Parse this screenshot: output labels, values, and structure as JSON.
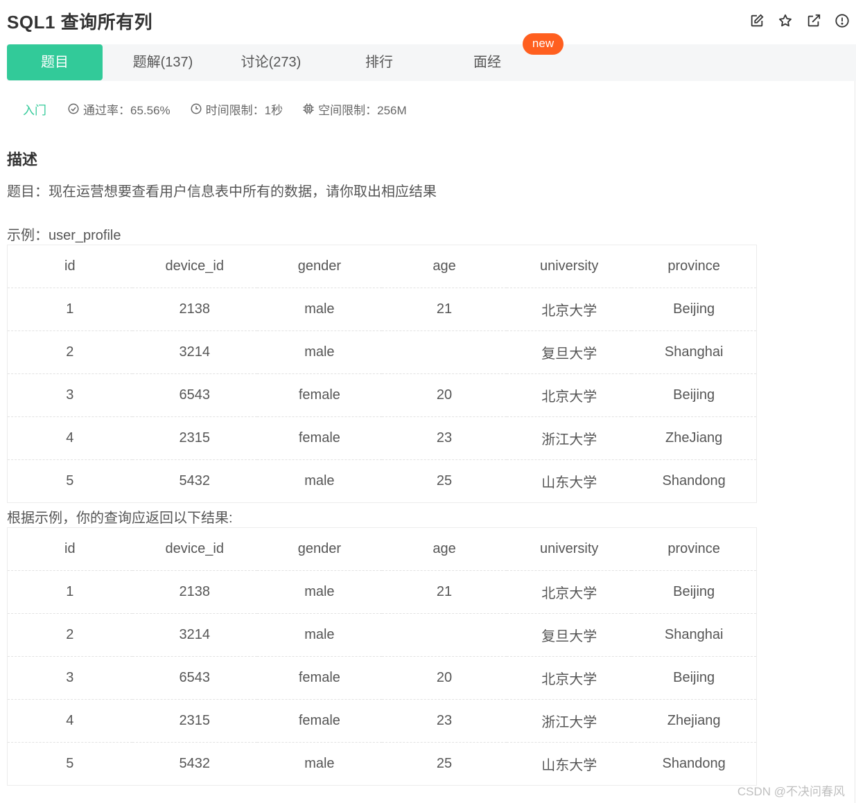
{
  "header": {
    "title": "SQL1  查询所有列",
    "tools": [
      "edit-icon",
      "star-icon",
      "external-link-icon",
      "info-icon"
    ]
  },
  "tabs": [
    {
      "label": "题目",
      "active": true
    },
    {
      "label": "题解(137)",
      "active": false
    },
    {
      "label": "讨论(273)",
      "active": false
    },
    {
      "label": "排行",
      "active": false
    },
    {
      "label": "面经",
      "active": false
    }
  ],
  "new_badge": "new",
  "meta": {
    "level": "入门",
    "pass_rate": "通过率：65.56%",
    "time_limit": "时间限制：1秒",
    "space_limit": "空间限制：256M"
  },
  "description": {
    "heading": "描述",
    "text": "题目：现在运营想要查看用户信息表中所有的数据，请你取出相应结果",
    "example_label": "示例：user_profile",
    "result_label": "根据示例，你的查询应返回以下结果:"
  },
  "example_table": {
    "columns": [
      "id",
      "device_id",
      "gender",
      "age",
      "university",
      "province"
    ],
    "rows": [
      [
        "1",
        "2138",
        "male",
        "21",
        "北京大学",
        "Beijing"
      ],
      [
        "2",
        "3214",
        "male",
        "",
        "复旦大学",
        "Shanghai"
      ],
      [
        "3",
        "6543",
        "female",
        "20",
        "北京大学",
        "Beijing"
      ],
      [
        "4",
        "2315",
        "female",
        "23",
        "浙江大学",
        "ZheJiang"
      ],
      [
        "5",
        "5432",
        "male",
        "25",
        "山东大学",
        "Shandong"
      ]
    ]
  },
  "result_table": {
    "columns": [
      "id",
      "device_id",
      "gender",
      "age",
      "university",
      "province"
    ],
    "rows": [
      [
        "1",
        "2138",
        "male",
        "21",
        "北京大学",
        "Beijing"
      ],
      [
        "2",
        "3214",
        "male",
        "",
        "复旦大学",
        "Shanghai"
      ],
      [
        "3",
        "6543",
        "female",
        "20",
        "北京大学",
        "Beijing"
      ],
      [
        "4",
        "2315",
        "female",
        "23",
        "浙江大学",
        "Zhejiang"
      ],
      [
        "5",
        "5432",
        "male",
        "25",
        "山东大学",
        "Shandong"
      ]
    ]
  },
  "watermark": "CSDN @不决问春风",
  "colors": {
    "accent": "#32ca99",
    "badge": "#ff5f1f",
    "tab_bg": "#f5f6f7"
  }
}
